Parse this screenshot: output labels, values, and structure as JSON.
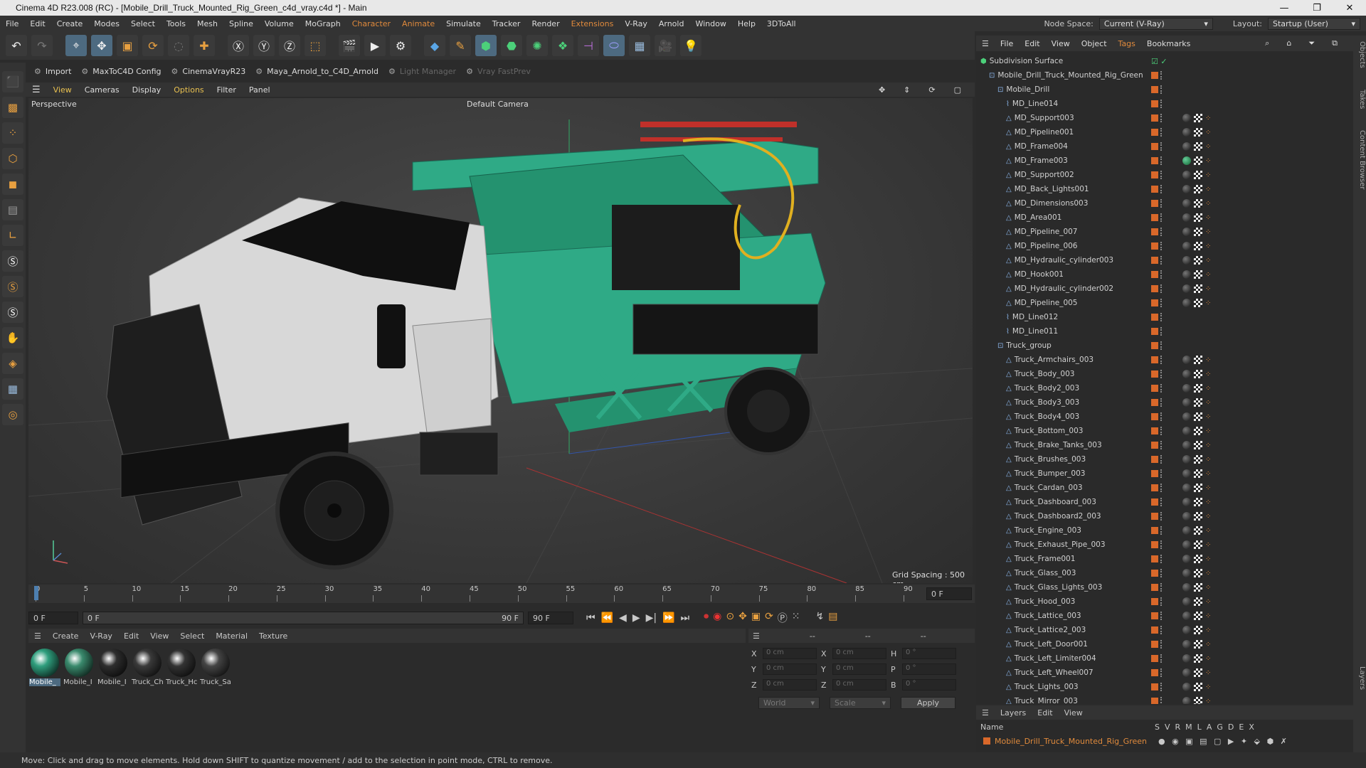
{
  "window": {
    "title": "Cinema 4D R23.008 (RC) - [Mobile_Drill_Truck_Mounted_Rig_Green_c4d_vray.c4d *] - Main",
    "controls": [
      "—",
      "❐",
      "✕"
    ]
  },
  "menubar": {
    "items": [
      "File",
      "Edit",
      "Create",
      "Modes",
      "Select",
      "Tools",
      "Mesh",
      "Spline",
      "Volume",
      "MoGraph",
      "Character",
      "Animate",
      "Simulate",
      "Tracker",
      "Render",
      "Extensions",
      "V-Ray",
      "Arnold",
      "Window",
      "Help",
      "3DToAll"
    ],
    "highlighted": [
      "Character",
      "Animate",
      "Extensions"
    ],
    "node_space_label": "Node Space:",
    "node_space_value": "Current (V-Ray)",
    "layout_label": "Layout:",
    "layout_value": "Startup (User)"
  },
  "scriptbar": {
    "items": [
      "Import",
      "MaxToC4D Config",
      "CinemaVrayR23",
      "Maya_Arnold_to_C4D_Arnold",
      "Light Manager",
      "Vray FastPrev"
    ],
    "disabled": [
      "Light Manager",
      "Vray FastPrev"
    ]
  },
  "viewport": {
    "menu": [
      "View",
      "Cameras",
      "Display",
      "Options",
      "Filter",
      "Panel"
    ],
    "highlighted": [
      "View",
      "Options"
    ],
    "name": "Perspective",
    "camera": "Default Camera",
    "grid_spacing": "Grid Spacing : 500 cm"
  },
  "timeline": {
    "ticks": [
      "0",
      "5",
      "10",
      "15",
      "20",
      "25",
      "30",
      "35",
      "40",
      "45",
      "50",
      "55",
      "60",
      "65",
      "70",
      "75",
      "80",
      "85",
      "90"
    ],
    "current_frame_right": "0 F",
    "start_frame": "0 F",
    "slider_start": "0 F",
    "slider_end": "90 F",
    "end_frame": "90 F"
  },
  "material_manager": {
    "menu": [
      "Create",
      "V-Ray",
      "Edit",
      "View",
      "Select",
      "Material",
      "Texture"
    ],
    "materials": [
      {
        "label": "Mobile_",
        "color": "#2f9e7d"
      },
      {
        "label": "Mobile_I",
        "color": "#3a8a6d"
      },
      {
        "label": "Mobile_I",
        "color": "#2e2e2e"
      },
      {
        "label": "Truck_Ch",
        "color": "#3a3a3a"
      },
      {
        "label": "Truck_Hc",
        "color": "#333333"
      },
      {
        "label": "Truck_Sa",
        "color": "#444444"
      }
    ]
  },
  "attributes": {
    "header_dashes": [
      "--",
      "--",
      "--"
    ],
    "rows": [
      {
        "a": "X",
        "av": "0 cm",
        "b": "X",
        "bv": "0 cm",
        "c": "H",
        "cv": "0 °"
      },
      {
        "a": "Y",
        "av": "0 cm",
        "b": "Y",
        "bv": "0 cm",
        "c": "P",
        "cv": "0 °"
      },
      {
        "a": "Z",
        "av": "0 cm",
        "b": "Z",
        "bv": "0 cm",
        "c": "B",
        "cv": "0 °"
      }
    ],
    "coord_mode": "World",
    "transform_mode": "Scale",
    "apply": "Apply"
  },
  "object_manager": {
    "menu": [
      "File",
      "Edit",
      "View",
      "Object",
      "Tags",
      "Bookmarks"
    ],
    "highlighted": [
      "Tags"
    ],
    "objects": [
      {
        "name": "Subdivision Surface",
        "indent": 0,
        "tags": "none"
      },
      {
        "name": "Mobile_Drill_Truck_Mounted_Rig_Green",
        "indent": 1,
        "tags": "none"
      },
      {
        "name": "Mobile_Drill",
        "indent": 2,
        "tags": "none"
      },
      {
        "name": "MD_Line014",
        "indent": 3,
        "tags": "none"
      },
      {
        "name": "MD_Support003",
        "indent": 3,
        "tags": "mat"
      },
      {
        "name": "MD_Pipeline001",
        "indent": 3,
        "tags": "mat"
      },
      {
        "name": "MD_Frame004",
        "indent": 3,
        "tags": "mat"
      },
      {
        "name": "MD_Frame003",
        "indent": 3,
        "tags": "green"
      },
      {
        "name": "MD_Support002",
        "indent": 3,
        "tags": "mat"
      },
      {
        "name": "MD_Back_Lights001",
        "indent": 3,
        "tags": "mat"
      },
      {
        "name": "MD_Dimensions003",
        "indent": 3,
        "tags": "mat"
      },
      {
        "name": "MD_Area001",
        "indent": 3,
        "tags": "mat"
      },
      {
        "name": "MD_Pipeline_007",
        "indent": 3,
        "tags": "mat"
      },
      {
        "name": "MD_Pipeline_006",
        "indent": 3,
        "tags": "mat"
      },
      {
        "name": "MD_Hydraulic_cylinder003",
        "indent": 3,
        "tags": "mat"
      },
      {
        "name": "MD_Hook001",
        "indent": 3,
        "tags": "mat"
      },
      {
        "name": "MD_Hydraulic_cylinder002",
        "indent": 3,
        "tags": "mat"
      },
      {
        "name": "MD_Pipeline_005",
        "indent": 3,
        "tags": "mat"
      },
      {
        "name": "MD_Line012",
        "indent": 3,
        "tags": "none"
      },
      {
        "name": "MD_Line011",
        "indent": 3,
        "tags": "none"
      },
      {
        "name": "Truck_group",
        "indent": 2,
        "tags": "none"
      },
      {
        "name": "Truck_Armchairs_003",
        "indent": 3,
        "tags": "mat"
      },
      {
        "name": "Truck_Body_003",
        "indent": 3,
        "tags": "mat"
      },
      {
        "name": "Truck_Body2_003",
        "indent": 3,
        "tags": "mat"
      },
      {
        "name": "Truck_Body3_003",
        "indent": 3,
        "tags": "mat"
      },
      {
        "name": "Truck_Body4_003",
        "indent": 3,
        "tags": "mat"
      },
      {
        "name": "Truck_Bottom_003",
        "indent": 3,
        "tags": "mat"
      },
      {
        "name": "Truck_Brake_Tanks_003",
        "indent": 3,
        "tags": "mat"
      },
      {
        "name": "Truck_Brushes_003",
        "indent": 3,
        "tags": "mat"
      },
      {
        "name": "Truck_Bumper_003",
        "indent": 3,
        "tags": "mat"
      },
      {
        "name": "Truck_Cardan_003",
        "indent": 3,
        "tags": "mat"
      },
      {
        "name": "Truck_Dashboard_003",
        "indent": 3,
        "tags": "mat"
      },
      {
        "name": "Truck_Dashboard2_003",
        "indent": 3,
        "tags": "mat"
      },
      {
        "name": "Truck_Engine_003",
        "indent": 3,
        "tags": "mat"
      },
      {
        "name": "Truck_Exhaust_Pipe_003",
        "indent": 3,
        "tags": "mat"
      },
      {
        "name": "Truck_Frame001",
        "indent": 3,
        "tags": "mat"
      },
      {
        "name": "Truck_Glass_003",
        "indent": 3,
        "tags": "mat"
      },
      {
        "name": "Truck_Glass_Lights_003",
        "indent": 3,
        "tags": "mat"
      },
      {
        "name": "Truck_Hood_003",
        "indent": 3,
        "tags": "mat"
      },
      {
        "name": "Truck_Lattice_003",
        "indent": 3,
        "tags": "mat"
      },
      {
        "name": "Truck_Lattice2_003",
        "indent": 3,
        "tags": "mat"
      },
      {
        "name": "Truck_Left_Door001",
        "indent": 3,
        "tags": "mat"
      },
      {
        "name": "Truck_Left_Limiter004",
        "indent": 3,
        "tags": "mat"
      },
      {
        "name": "Truck_Left_Wheel007",
        "indent": 3,
        "tags": "mat"
      },
      {
        "name": "Truck_Lights_003",
        "indent": 3,
        "tags": "mat"
      },
      {
        "name": "Truck_Mirror_003",
        "indent": 3,
        "tags": "mat"
      }
    ]
  },
  "layer_manager": {
    "menu": [
      "Layers",
      "Edit",
      "View"
    ],
    "name_header": "Name",
    "flag_headers": [
      "S",
      "V",
      "R",
      "M",
      "L",
      "A",
      "G",
      "D",
      "E",
      "X"
    ],
    "layer_name": "Mobile_Drill_Truck_Mounted_Rig_Green"
  },
  "right_strip": [
    "Objects",
    "Takes",
    "Content Browser",
    "Layers"
  ],
  "statusbar": {
    "text": "Move: Click and drag to move elements. Hold down SHIFT to quantize movement / add to the selection in point mode, CTRL to remove."
  },
  "colors": {
    "accent_orange": "#e08a3c",
    "drill_green": "#2faa86",
    "truck_white": "#d8d8d8",
    "selection_blue": "#4d6a80"
  }
}
